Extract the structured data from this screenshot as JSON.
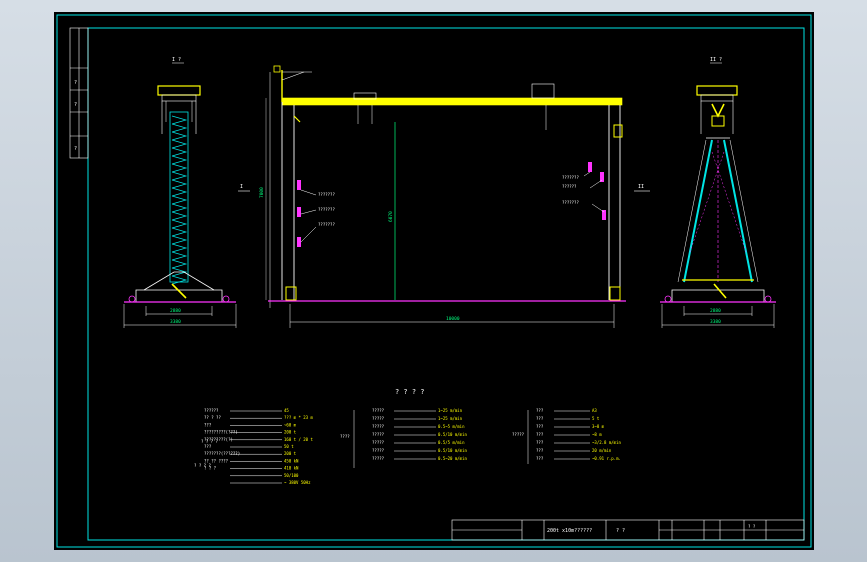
{
  "colors": {
    "frame": "#00e5e5",
    "beam": "#ffff00",
    "leg": "#ffffff",
    "ladder": "#00e5e5",
    "dim": "#00ff7f",
    "magenta": "#ff33ff",
    "note": "#ffffff",
    "yellow_text": "#ffff00",
    "background": "#000000",
    "viewport_bg": "#c7d0d9"
  },
  "views": {
    "left_view_label": "I ?",
    "right_view_label": "II ?",
    "left_section_marker": "I",
    "right_section_marker": "II",
    "left_width_dim": "2880",
    "left_base_dim": "3380",
    "main_span_dim": "10000",
    "main_height_dim_left": "7000",
    "main_height_dim_center": "6070",
    "right_width_dim": "2880",
    "right_base_dim": "3380",
    "front_callouts_left": [
      "???????",
      "???????",
      "???????"
    ],
    "front_callouts_right": [
      "???????",
      "??????",
      "???????"
    ]
  },
  "notes_title": "? ? ? ?",
  "spec_left": {
    "labels": [
      "??????",
      "?? ? ??",
      "???",
      "?????????(???)",
      "?????????(?)",
      "???",
      "???????(??????)",
      "?? ?? ????",
      "? ? ?"
    ],
    "values": [
      "45",
      "??? m * 23 m",
      "~60 m",
      "200 t",
      "160 t / 20 t",
      "50 t",
      "200 t",
      "450 kN",
      "410 kN",
      "50/100",
      "~ 380V 50Hz"
    ],
    "group_labels": [
      "? ? ? ?",
      "? ? ? ?"
    ]
  },
  "spec_mid": {
    "group_label": "????",
    "labels": [
      "?????",
      "?????",
      "?????",
      "?????",
      "?????",
      "?????",
      "?????"
    ],
    "values": [
      "1~25 m/min",
      "1~25 m/min",
      "0.5~5 m/min",
      "0.5/10 m/min",
      "0.5/5 m/min",
      "0.5/10 m/min",
      "0.5~20 m/min"
    ]
  },
  "spec_right": {
    "group_label": "?????",
    "labels": [
      "???",
      "???",
      "???",
      "???",
      "???",
      "???",
      "???"
    ],
    "values": [
      "A3",
      "5 t",
      "3~8 m",
      "~8 m",
      "~3/2.8 m/min",
      "20 m/min",
      "~0.91 r.p.m."
    ]
  },
  "title_block": {
    "drawing_name": "200t x10m??????",
    "scale": "? ?",
    "sheet_label": "? ?"
  },
  "side_strip_labels": [
    "?",
    "?",
    "?"
  ]
}
